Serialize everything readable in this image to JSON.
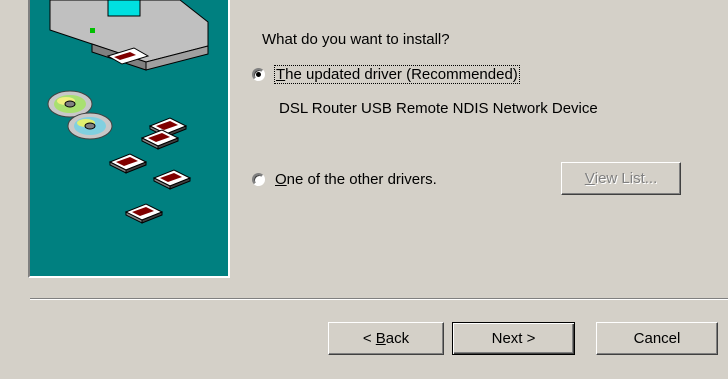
{
  "question": "What do you want to install?",
  "options": [
    {
      "label_prefix": "",
      "mnemonic": "T",
      "label_rest": "he updated driver (Recommended)",
      "selected": true
    },
    {
      "label_prefix": "",
      "mnemonic": "O",
      "label_rest": "ne of the other drivers.",
      "selected": false
    }
  ],
  "device_name": "DSL Router USB Remote NDIS Network Device",
  "buttons": {
    "view_list_mnemonic": "V",
    "view_list_rest": "iew List...",
    "back_prefix": "< ",
    "back_mnemonic": "B",
    "back_rest": "ack",
    "next_label": "Next >",
    "cancel_label": "Cancel"
  },
  "illustration": {
    "background": "#008080",
    "icons": [
      "computer-icon",
      "cd-disc-icon",
      "floppy-disk-icon"
    ]
  }
}
